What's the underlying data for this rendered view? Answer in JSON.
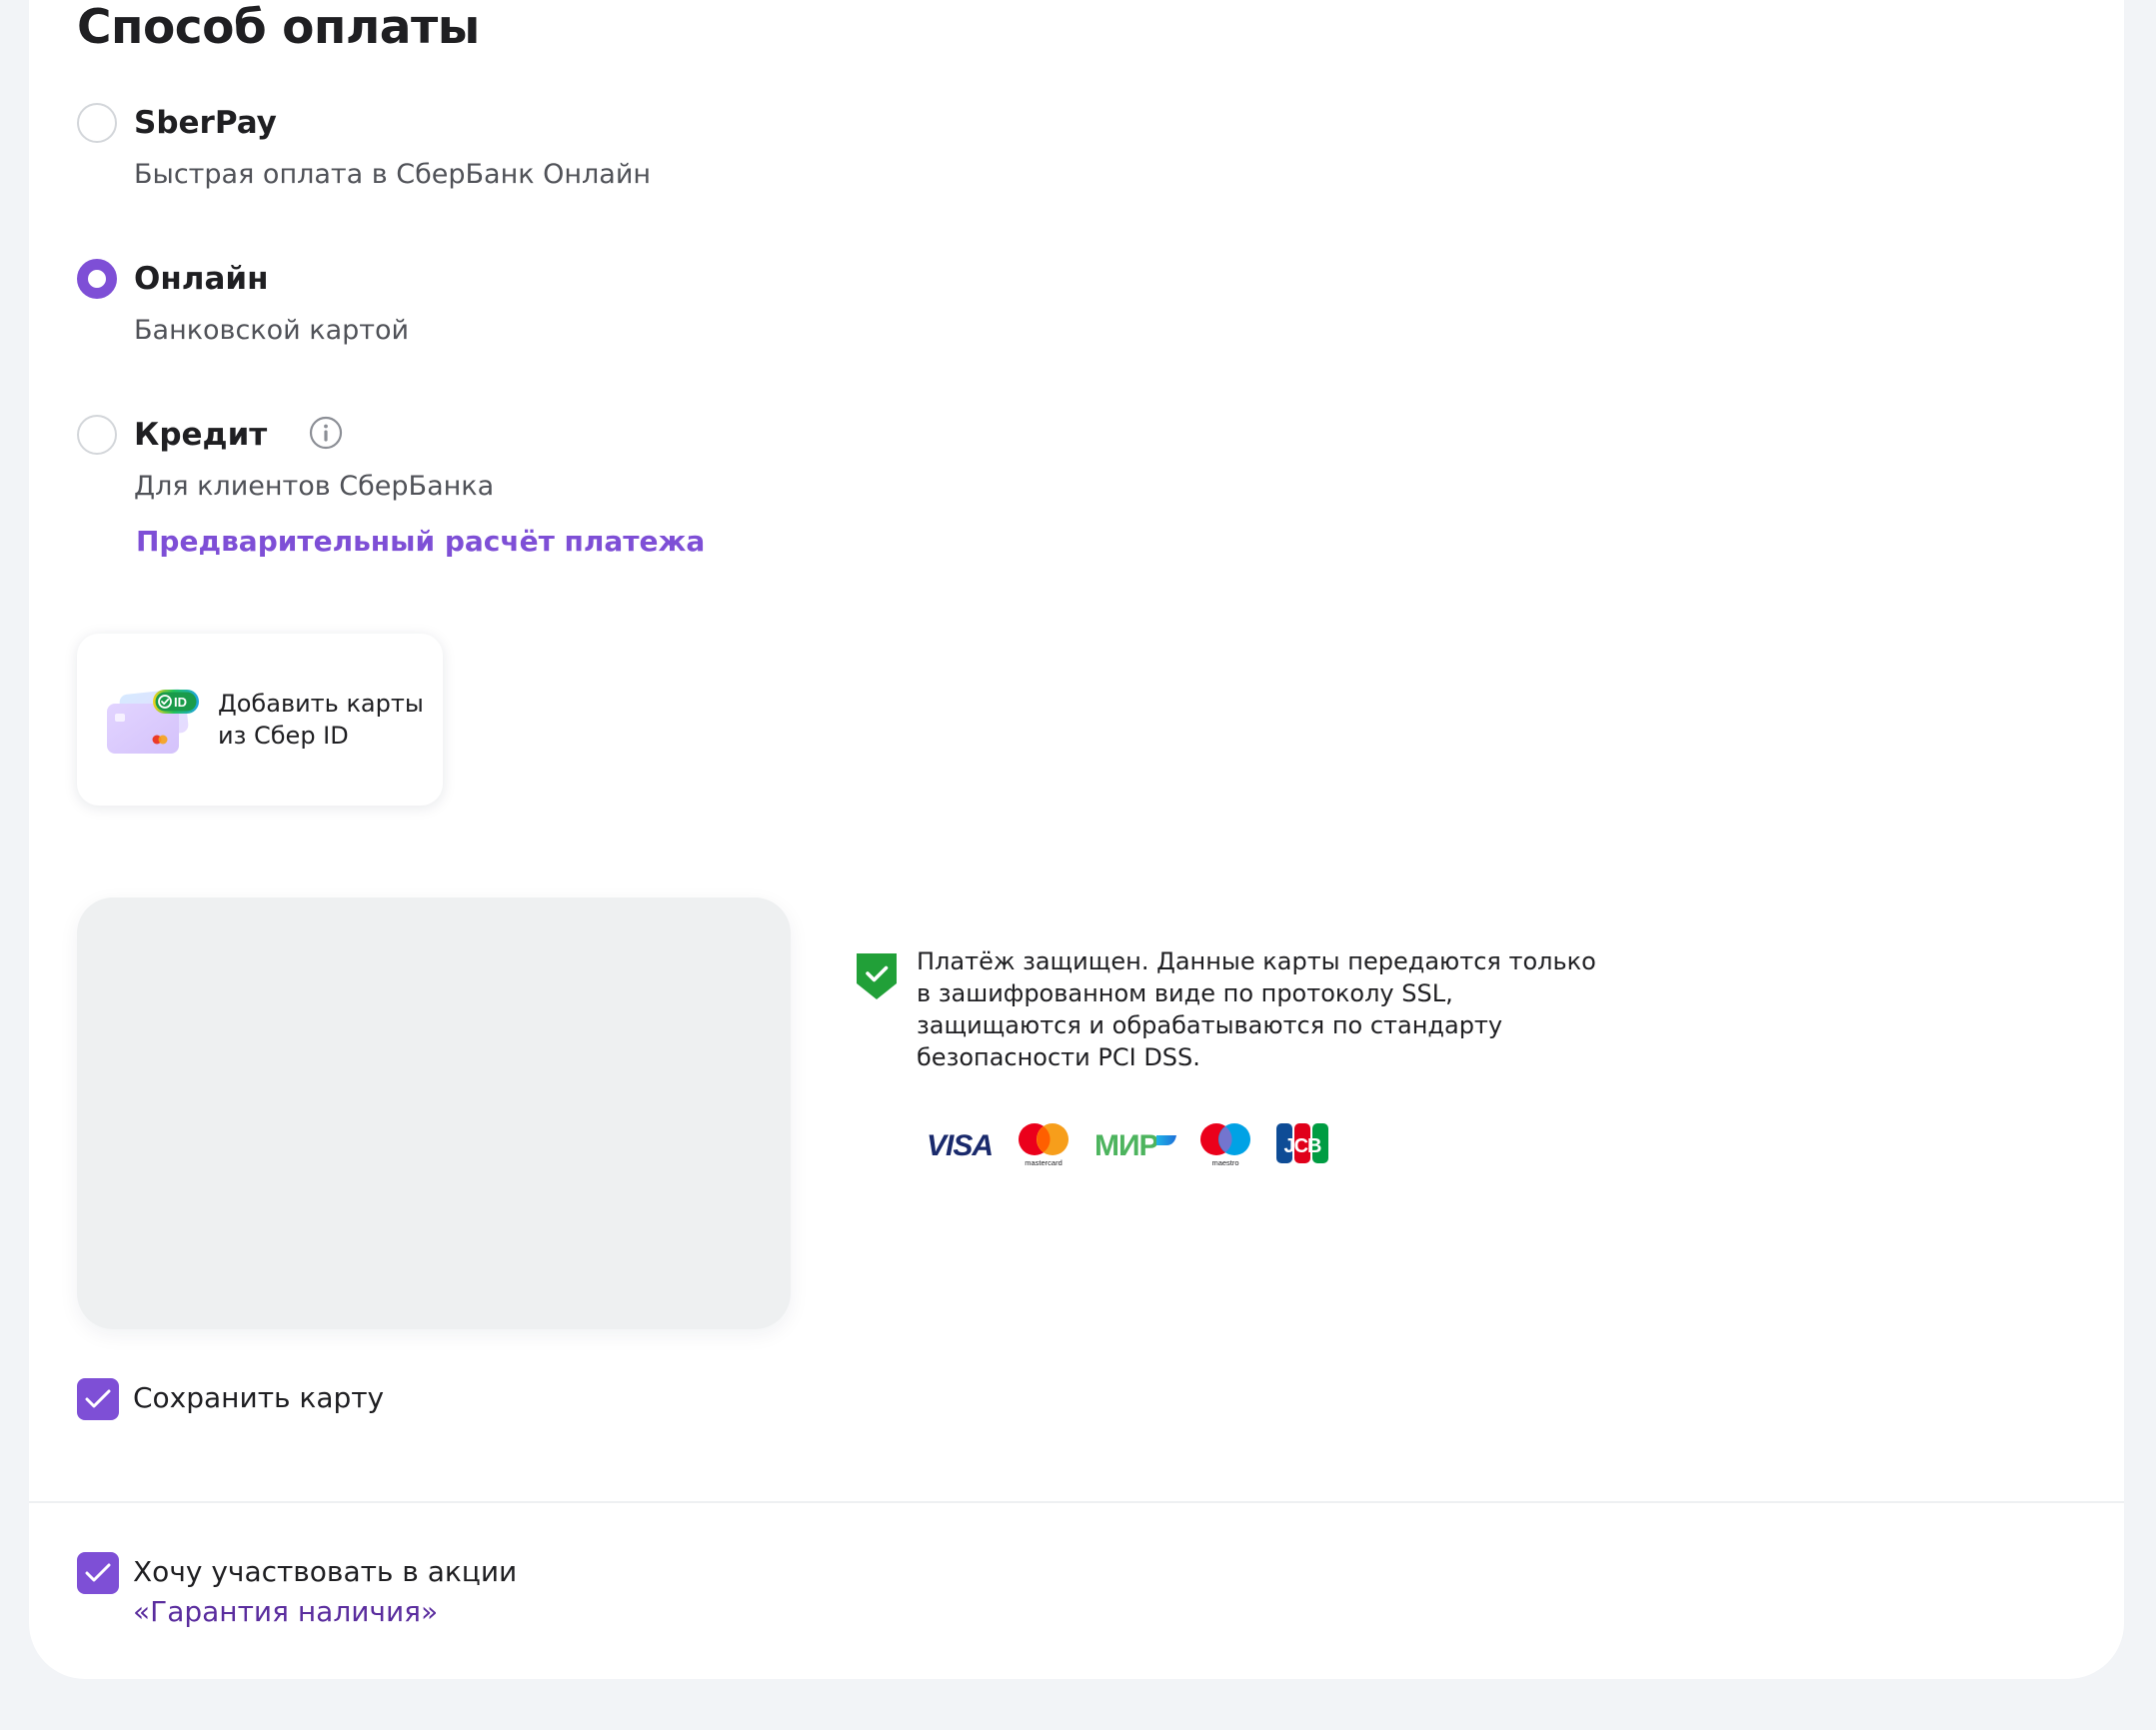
{
  "section": {
    "title": "Способ оплаты"
  },
  "payment_options": [
    {
      "label": "SberPay",
      "subtitle": "Быстрая оплата в СберБанк Онлайн",
      "selected": false
    },
    {
      "label": "Онлайн",
      "subtitle": "Банковской картой",
      "selected": true
    },
    {
      "label": "Кредит",
      "subtitle": "Для клиентов СберБанка",
      "selected": false,
      "link": "Предварительный расчёт платежа"
    }
  ],
  "sber_id": {
    "badge": "ID",
    "line1": "Добавить карты",
    "line2": "из Сбер ID"
  },
  "security": {
    "text": "Платёж защищен. Данные карты передаются только в зашифрованном виде по протоколу SSL, защищаются и обрабатываются по стандарту безопасности PCI DSS."
  },
  "payment_systems": {
    "visa": "VISA",
    "mastercard": "mastercard",
    "mir": "МИР",
    "maestro": "maestro",
    "jcb": "JCB"
  },
  "save_card": {
    "label": "Сохранить карту",
    "checked": true
  },
  "promo": {
    "label": "Хочу участвовать в акции",
    "link": "«Гарантия наличия»",
    "checked": true
  },
  "colors": {
    "accent": "#7e4fd6",
    "shield_green": "#21a038",
    "promo_link": "#5a2d9e"
  }
}
